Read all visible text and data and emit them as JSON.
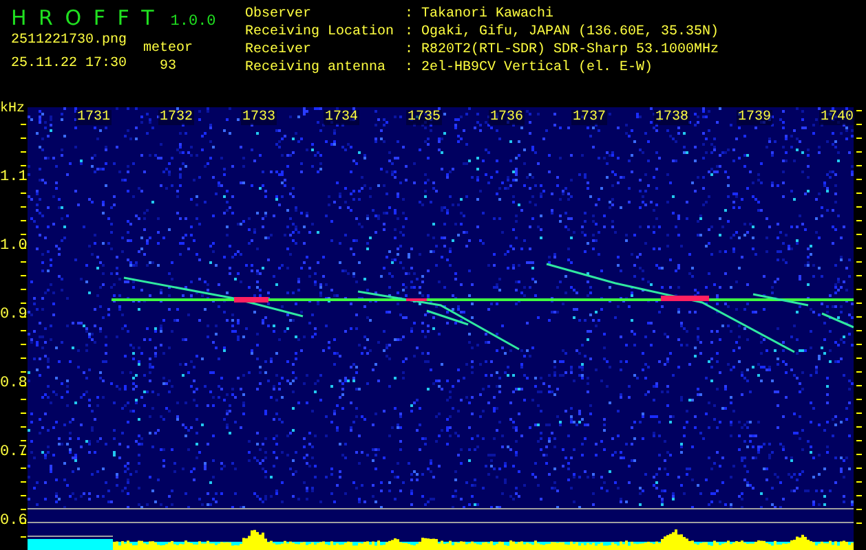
{
  "header": {
    "app_name": "H R O F F T",
    "version": "1.0.0",
    "filename": "2511221730.png",
    "datetime": "25.11.22 17:30",
    "mode_label": "meteor",
    "count": "93"
  },
  "info": [
    {
      "label": "Observer",
      "separator": ":",
      "value": "Takanori Kawachi"
    },
    {
      "label": "Receiving Location",
      "separator": ":",
      "value": "Ogaki, Gifu, JAPAN (136.60E, 35.35N)"
    },
    {
      "label": "Receiver",
      "separator": ":",
      "value": "R820T2(RTL-SDR) SDR-Sharp 53.1000MHz"
    },
    {
      "label": "Receiving antenna",
      "separator": ":",
      "value": "2el-HB9CV Vertical (el. E-W)"
    }
  ],
  "spectrogram": {
    "unit": "kHz",
    "time_labels": [
      "1731",
      "1732",
      "1733",
      "1734",
      "1735",
      "1736",
      "1737",
      "1738",
      "1739",
      "1740"
    ],
    "freq_labels": [
      "1.1",
      "1.0",
      "0.9",
      "0.8",
      "0.7",
      "0.6"
    ]
  }
}
